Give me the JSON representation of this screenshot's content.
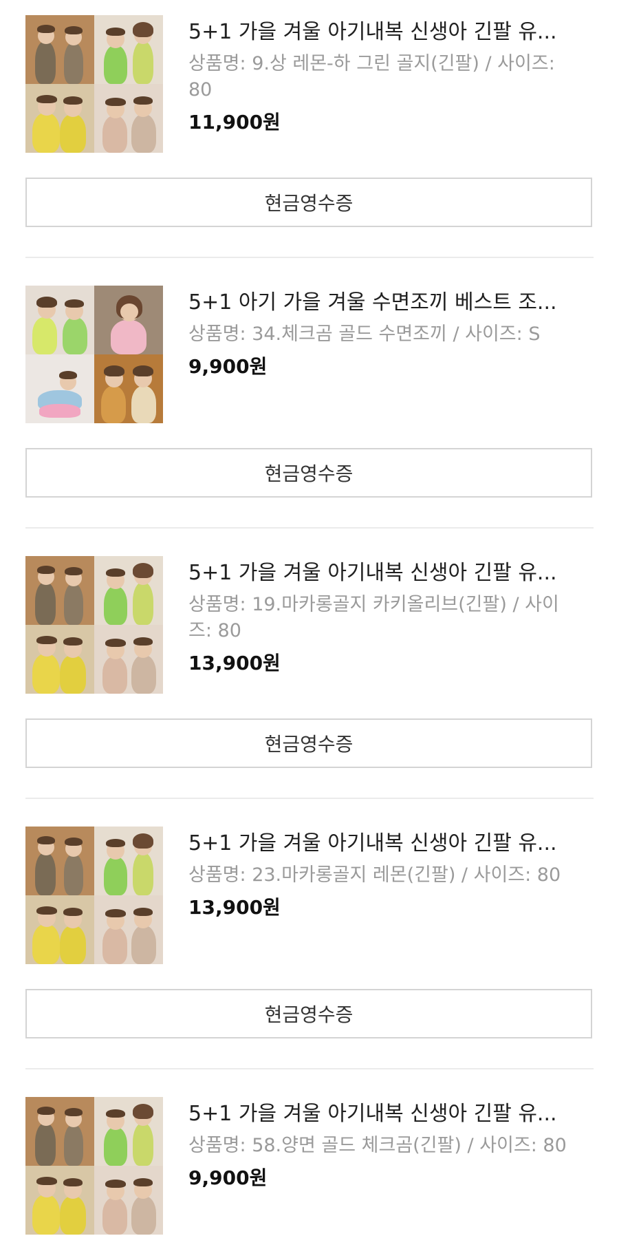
{
  "orders": [
    {
      "title": "5+1 가을 겨울 아기내복 신생아 긴팔 유...",
      "option": "상품명: 9.상 레몬-하 그린 골지(긴팔) / 사이즈: 80",
      "price": "11,900원",
      "button_label": "현금영수증",
      "thumbnail_icon": "baby-clothing-photo-grid"
    },
    {
      "title": "5+1 아기 가을 겨울 수면조끼 베스트 조...",
      "option": "상품명: 34.체크곰 골드 수면조끼 / 사이즈: S",
      "price": "9,900원",
      "button_label": "현금영수증",
      "thumbnail_icon": "baby-vest-photo-grid"
    },
    {
      "title": "5+1 가을 겨울 아기내복 신생아 긴팔 유...",
      "option": "상품명: 19.마카롱골지 카키올리브(긴팔) / 사이즈: 80",
      "price": "13,900원",
      "button_label": "현금영수증",
      "thumbnail_icon": "baby-clothing-photo-grid"
    },
    {
      "title": "5+1 가을 겨울 아기내복 신생아 긴팔 유...",
      "option": "상품명: 23.마카롱골지 레몬(긴팔) / 사이즈: 80",
      "price": "13,900원",
      "button_label": "현금영수증",
      "thumbnail_icon": "baby-clothing-photo-grid"
    },
    {
      "title": "5+1 가을 겨울 아기내복 신생아 긴팔 유...",
      "option": "상품명: 58.양면 골드 체크곰(긴팔) / 사이즈: 80",
      "price": "9,900원",
      "button_label": "",
      "thumbnail_icon": "baby-clothing-photo-grid"
    }
  ],
  "colors": {
    "title_text": "#202020",
    "option_text": "#9a9a9a",
    "price_text": "#111111",
    "button_border": "#d4d4d4",
    "divider": "#ebebeb"
  }
}
